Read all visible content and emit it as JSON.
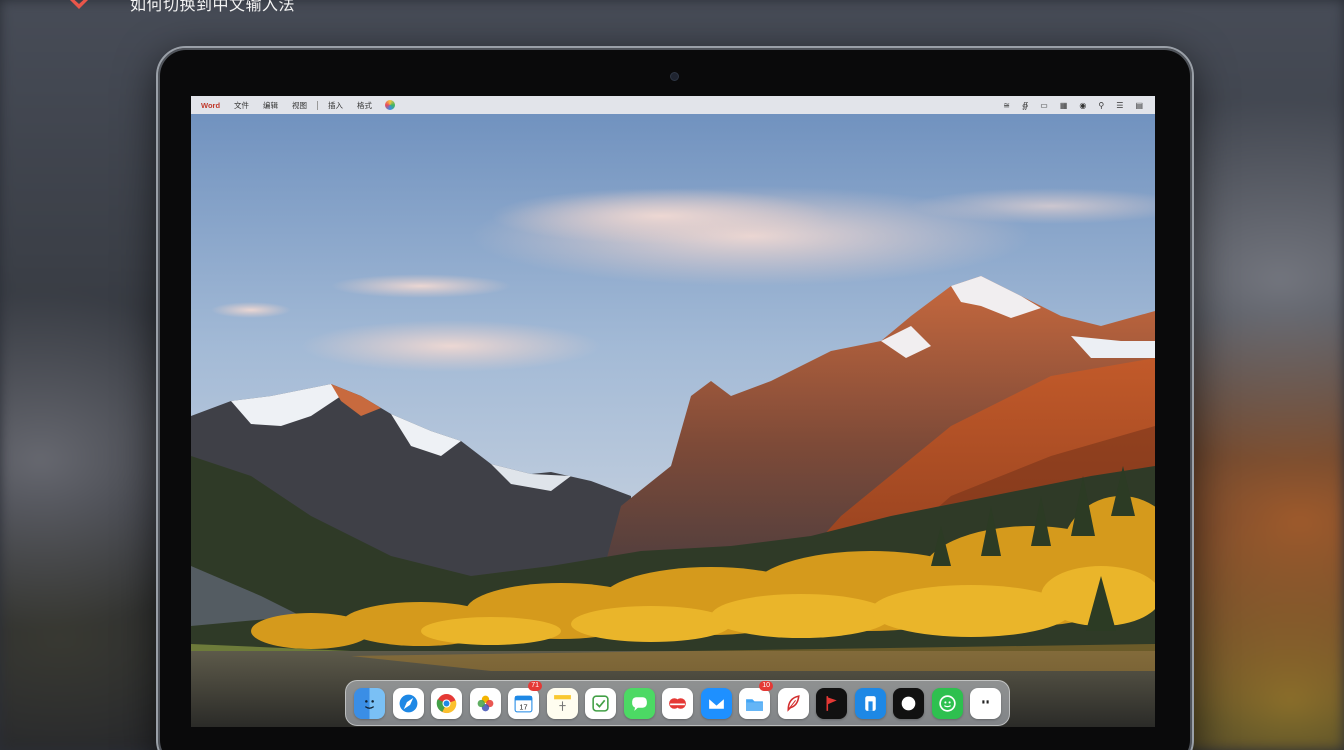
{
  "caption": {
    "text": "如何切换到中文输入法"
  },
  "menubar": {
    "app_name": "Word",
    "items": [
      "文件",
      "编辑",
      "视图",
      "插入",
      "格式"
    ],
    "right_icons": [
      "wifi-icon",
      "bluetooth-icon",
      "battery-icon",
      "control-center-icon",
      "siri-icon",
      "search-icon",
      "notification-icon",
      "clock-icon"
    ]
  },
  "dock": {
    "apps": [
      {
        "name": "finder",
        "color": "#3a8ee6"
      },
      {
        "name": "safari",
        "color": "#ffffff"
      },
      {
        "name": "chrome",
        "color": "#ffffff"
      },
      {
        "name": "photos",
        "color": "#ffffff"
      },
      {
        "name": "calendar",
        "color": "#ffffff",
        "badge": "71"
      },
      {
        "name": "notes",
        "color": "#fff8dc"
      },
      {
        "name": "reminders-app",
        "color": "#ffffff"
      },
      {
        "name": "messages",
        "color": "#4cd964"
      },
      {
        "name": "music-app",
        "color": "#ffffff"
      },
      {
        "name": "mail",
        "color": "#1e90ff"
      },
      {
        "name": "files",
        "color": "#ffffff",
        "badge": "10"
      },
      {
        "name": "feather-app",
        "color": "#ffffff"
      },
      {
        "name": "flag-app",
        "color": "#111111"
      },
      {
        "name": "app-store",
        "color": "#1e88e5"
      },
      {
        "name": "circle-app",
        "color": "#111111"
      },
      {
        "name": "wechat",
        "color": "#2ec04f"
      },
      {
        "name": "dots-app",
        "color": "#ffffff"
      }
    ]
  }
}
